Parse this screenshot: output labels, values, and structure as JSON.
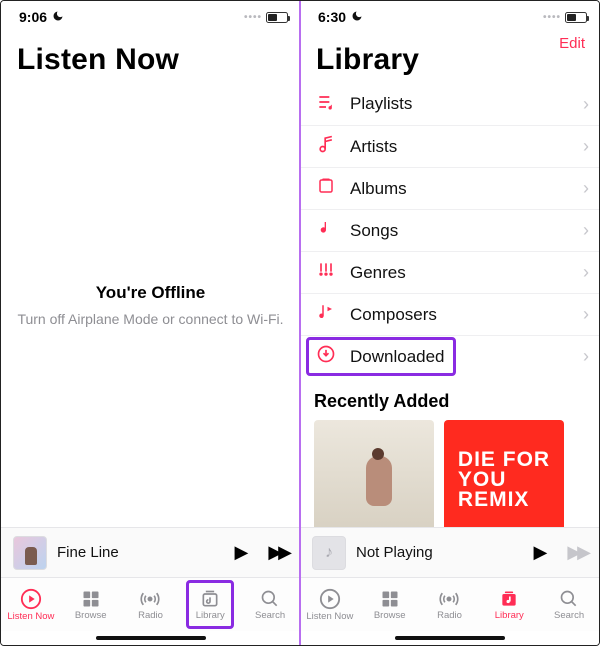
{
  "left": {
    "status": {
      "time": "9:06"
    },
    "title": "Listen Now",
    "offline": {
      "heading": "You're Offline",
      "body": "Turn off Airplane Mode or connect to Wi-Fi."
    },
    "miniplayer": {
      "track": "Fine Line"
    },
    "tabs": {
      "listen": "Listen Now",
      "browse": "Browse",
      "radio": "Radio",
      "library": "Library",
      "search": "Search"
    }
  },
  "right": {
    "status": {
      "time": "6:30"
    },
    "edit": "Edit",
    "title": "Library",
    "rows": {
      "playlists": "Playlists",
      "artists": "Artists",
      "albums": "Albums",
      "songs": "Songs",
      "genres": "Genres",
      "composers": "Composers",
      "downloaded": "Downloaded"
    },
    "recently": "Recently Added",
    "album2": {
      "l1": "DIE FOR",
      "l2": "YOU",
      "l3": "REMIX"
    },
    "miniplayer": {
      "track": "Not Playing"
    },
    "tabs": {
      "listen": "Listen Now",
      "browse": "Browse",
      "radio": "Radio",
      "library": "Library",
      "search": "Search"
    }
  }
}
